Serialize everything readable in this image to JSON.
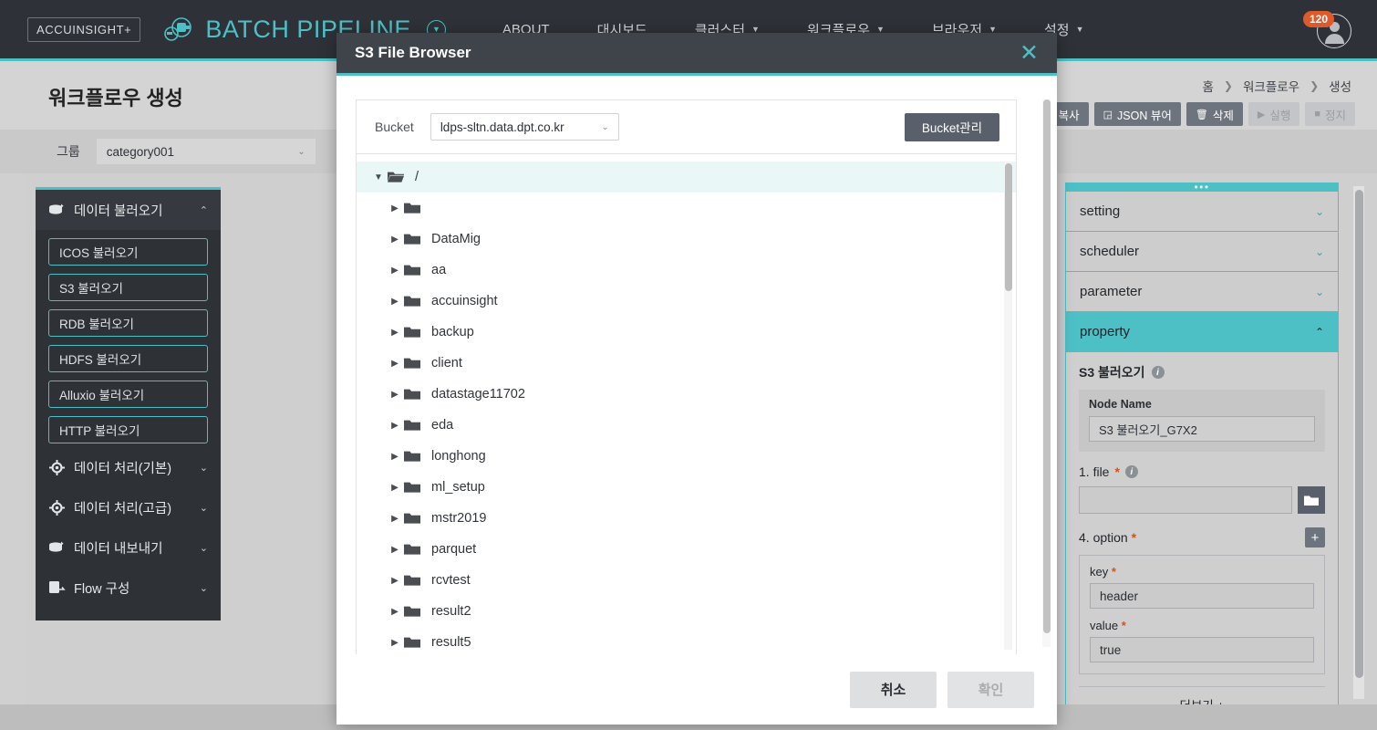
{
  "topnav": {
    "brand_box": "ACCUINSIGHT+",
    "logo_text": "BATCH PIPELINE",
    "logo_icon": "cloud-pipeline-icon",
    "logo_caret_icon": "chevron-down-circle-icon",
    "items": [
      {
        "label": "ABOUT",
        "caret": ""
      },
      {
        "label": "대시보드",
        "caret": ""
      },
      {
        "label": "클러스터",
        "caret": "▼"
      },
      {
        "label": "워크플로우",
        "caret": "▼"
      },
      {
        "label": "브라우저",
        "caret": "▼"
      },
      {
        "label": "설정",
        "caret": "▼"
      }
    ],
    "notification_count": "120",
    "avatar_icon": "user-avatar-icon"
  },
  "page": {
    "title": "워크플로우 생성",
    "breadcrumb": [
      "홈",
      "워크플로우",
      "생성"
    ],
    "breadcrumb_sep": "❯",
    "toolbar": [
      {
        "label": "복사",
        "icon": "copy-icon",
        "glyph": "🗐",
        "disabled": false
      },
      {
        "label": "JSON 뷰어",
        "icon": "json-viewer-icon",
        "glyph": "◲",
        "disabled": false
      },
      {
        "label": "삭제",
        "icon": "trash-icon",
        "glyph": "🗑",
        "disabled": false
      },
      {
        "label": "실행",
        "icon": "play-icon",
        "glyph": "▶",
        "disabled": true
      },
      {
        "label": "정지",
        "icon": "stop-icon",
        "glyph": "■",
        "disabled": true
      }
    ],
    "group_label": "그룹",
    "group_value": "category001",
    "caret": "⌄"
  },
  "palette": {
    "sections": [
      {
        "label": "데이터 불러오기",
        "icon": "database-import-icon",
        "expanded": true,
        "caret": "⌃",
        "items": [
          "ICOS 불러오기",
          "S3 불러오기",
          "RDB 불러오기",
          "HDFS 불러오기",
          "Alluxio 불러오기",
          "HTTP 불러오기"
        ]
      },
      {
        "label": "데이터 처리(기본)",
        "icon": "gear-icon",
        "expanded": false,
        "caret": "⌄",
        "items": []
      },
      {
        "label": "데이터 처리(고급)",
        "icon": "gear-icon",
        "expanded": false,
        "caret": "⌄",
        "items": []
      },
      {
        "label": "데이터 내보내기",
        "icon": "database-export-icon",
        "expanded": false,
        "caret": "⌄",
        "items": []
      },
      {
        "label": "Flow 구성",
        "icon": "flow-icon",
        "expanded": false,
        "caret": "⌄",
        "items": []
      }
    ]
  },
  "right_panel": {
    "grip_icon": "drag-handle-dots",
    "grip_dots": "•••",
    "accordions": [
      {
        "label": "setting",
        "active": false,
        "caret": "⌄"
      },
      {
        "label": "scheduler",
        "active": false,
        "caret": "⌄"
      },
      {
        "label": "parameter",
        "active": false,
        "caret": "⌄"
      },
      {
        "label": "property",
        "active": true,
        "caret": "⌃"
      }
    ],
    "property": {
      "title": "S3 불러오기",
      "info_icon": "info-icon",
      "info_glyph": "i",
      "node_name_label": "Node Name",
      "node_name_value": "S3 불러오기_G7X2",
      "file_label": "1. file",
      "file_value": "",
      "required_mark": "*",
      "folder_icon": "folder-icon",
      "option_label": "4. option",
      "add_icon": "plus-icon",
      "add_glyph": "+",
      "key_label": "key",
      "key_value": "header",
      "value_label": "value",
      "value_value": "true",
      "more_label": "더보기",
      "more_glyph": "+"
    }
  },
  "modal": {
    "title": "S3 File Browser",
    "close_icon": "close-icon",
    "close_glyph": "✕",
    "bucket_label": "Bucket",
    "bucket_value": "ldps-sltn.data.dpt.co.kr",
    "bucket_caret": "⌄",
    "bucket_manage_label": "Bucket관리",
    "tree": [
      {
        "name": "/",
        "level": 0,
        "expanded": true,
        "twisty": "▼",
        "icon": "folder-open-icon",
        "selected": true
      },
      {
        "name": "",
        "level": 1,
        "expanded": false,
        "twisty": "▶",
        "icon": "folder-icon",
        "selected": false
      },
      {
        "name": "DataMig",
        "level": 1,
        "expanded": false,
        "twisty": "▶",
        "icon": "folder-icon",
        "selected": false
      },
      {
        "name": "aa",
        "level": 1,
        "expanded": false,
        "twisty": "▶",
        "icon": "folder-icon",
        "selected": false
      },
      {
        "name": "accuinsight",
        "level": 1,
        "expanded": false,
        "twisty": "▶",
        "icon": "folder-icon",
        "selected": false
      },
      {
        "name": "backup",
        "level": 1,
        "expanded": false,
        "twisty": "▶",
        "icon": "folder-icon",
        "selected": false
      },
      {
        "name": "client",
        "level": 1,
        "expanded": false,
        "twisty": "▶",
        "icon": "folder-icon",
        "selected": false
      },
      {
        "name": "datastage11702",
        "level": 1,
        "expanded": false,
        "twisty": "▶",
        "icon": "folder-icon",
        "selected": false
      },
      {
        "name": "eda",
        "level": 1,
        "expanded": false,
        "twisty": "▶",
        "icon": "folder-icon",
        "selected": false
      },
      {
        "name": "longhong",
        "level": 1,
        "expanded": false,
        "twisty": "▶",
        "icon": "folder-icon",
        "selected": false
      },
      {
        "name": "ml_setup",
        "level": 1,
        "expanded": false,
        "twisty": "▶",
        "icon": "folder-icon",
        "selected": false
      },
      {
        "name": "mstr2019",
        "level": 1,
        "expanded": false,
        "twisty": "▶",
        "icon": "folder-icon",
        "selected": false
      },
      {
        "name": "parquet",
        "level": 1,
        "expanded": false,
        "twisty": "▶",
        "icon": "folder-icon",
        "selected": false
      },
      {
        "name": "rcvtest",
        "level": 1,
        "expanded": false,
        "twisty": "▶",
        "icon": "folder-icon",
        "selected": false
      },
      {
        "name": "result2",
        "level": 1,
        "expanded": false,
        "twisty": "▶",
        "icon": "folder-icon",
        "selected": false
      },
      {
        "name": "result5",
        "level": 1,
        "expanded": false,
        "twisty": "▶",
        "icon": "folder-icon",
        "selected": false
      }
    ],
    "cancel_label": "취소",
    "confirm_label": "확인"
  },
  "colors": {
    "accent_teal": "#4dc0c6",
    "header_dark": "#2e3137",
    "modal_header": "#3f434a",
    "badge_orange": "#de5a2a",
    "required_red": "#d4521e",
    "canvas_gray": "#d0d0d0"
  }
}
